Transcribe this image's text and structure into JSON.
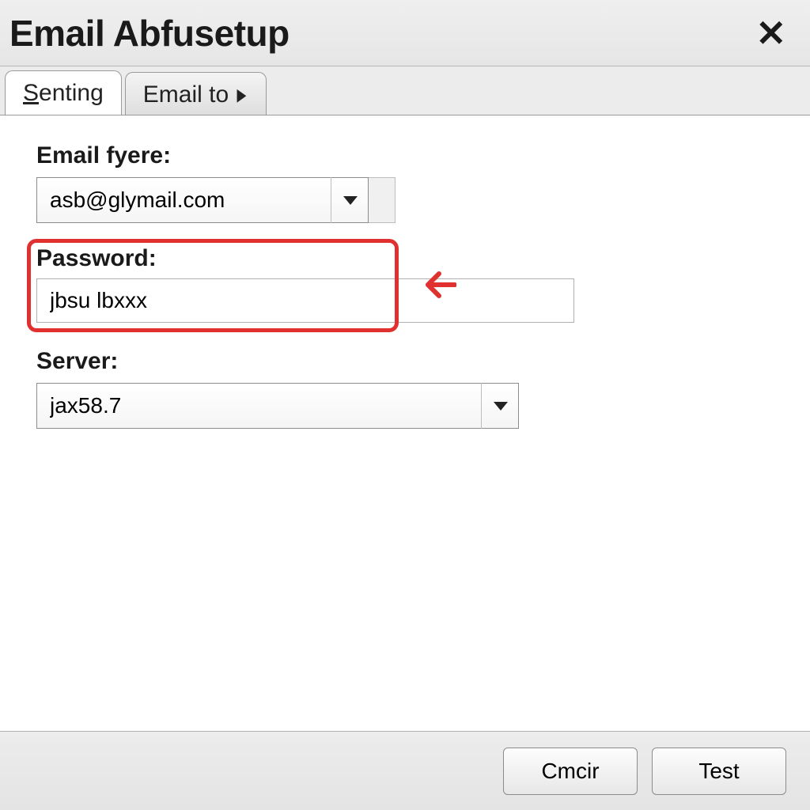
{
  "window": {
    "title": "Email Abfusetup"
  },
  "tabs": [
    {
      "label": "Senting",
      "active": true
    },
    {
      "label": "Email to",
      "active": false,
      "has_submenu": true
    }
  ],
  "fields": {
    "email": {
      "label": "Email fyere:",
      "value": "asb@glymail.com"
    },
    "password": {
      "label": "Password:",
      "value": "jbsu lbxxx",
      "highlighted": true
    },
    "server": {
      "label": "Server:",
      "value": "jax58.7"
    }
  },
  "annotation": {
    "arrow_color": "#e03030",
    "highlight_color": "#e03030"
  },
  "buttons": {
    "cmcir": "Cmcir",
    "test": "Test"
  }
}
